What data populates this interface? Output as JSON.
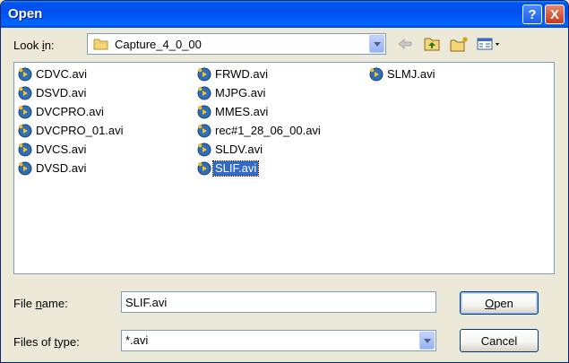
{
  "window": {
    "title": "Open",
    "help_label": "?",
    "close_label": "X"
  },
  "lookin": {
    "label_pre": "Look ",
    "label_ul": "i",
    "label_post": "n:",
    "value": "Capture_4_0_00"
  },
  "files": [
    {
      "name": "CDVC.avi"
    },
    {
      "name": "DSVD.avi"
    },
    {
      "name": "DVCPRO.avi"
    },
    {
      "name": "DVCPRO_01.avi"
    },
    {
      "name": "DVCS.avi"
    },
    {
      "name": "DVSD.avi"
    },
    {
      "name": "FRWD.avi"
    },
    {
      "name": "MJPG.avi"
    },
    {
      "name": "MMES.avi"
    },
    {
      "name": "rec#1_28_06_00.avi"
    },
    {
      "name": "SLDV.avi"
    },
    {
      "name": "SLIF.avi",
      "selected": true
    },
    {
      "name": "SLMJ.avi"
    }
  ],
  "filename": {
    "label_pre": "File ",
    "label_ul": "n",
    "label_post": "ame:",
    "value": "SLIF.avi"
  },
  "filetype": {
    "label_pre": "Files of ",
    "label_ul": "t",
    "label_post": "ype:",
    "value": "*.avi"
  },
  "buttons": {
    "open_ul": "O",
    "open_rest": "pen",
    "cancel": "Cancel"
  }
}
